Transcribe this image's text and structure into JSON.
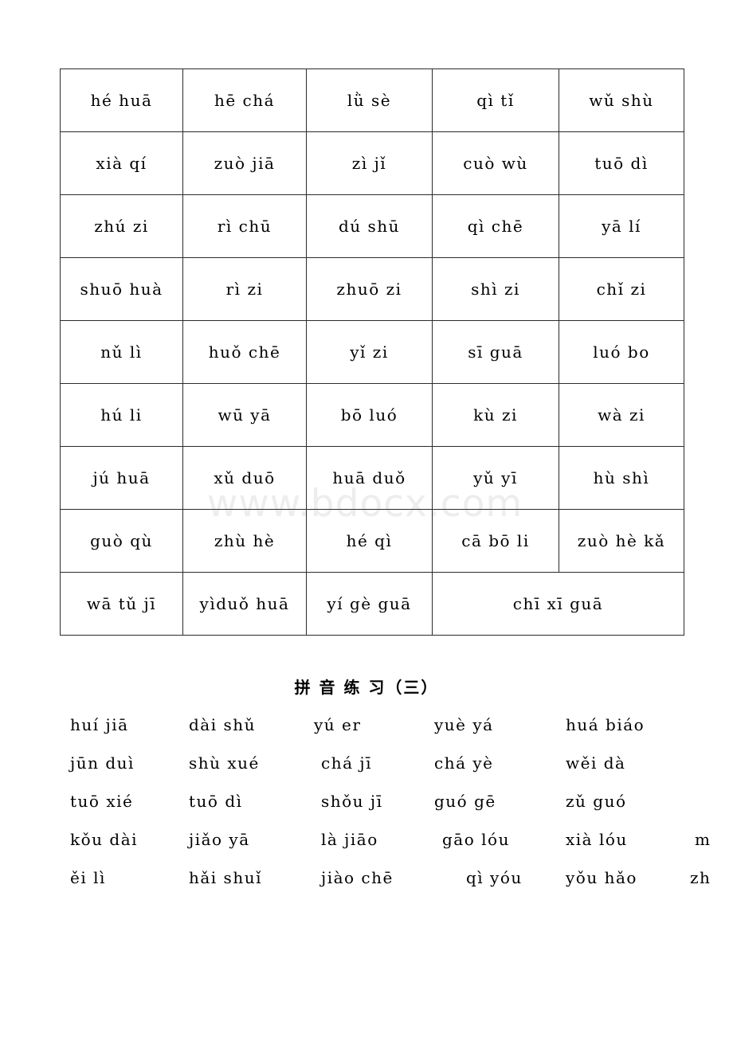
{
  "watermark": {
    "text": "www.bdocx.com",
    "color": "#ededed"
  },
  "pinyin_table": {
    "rows": [
      [
        "hé huā",
        "hē chá",
        "lǜ sè",
        "qì tǐ",
        "wǔ shù"
      ],
      [
        "xià qí",
        "zuò jiā",
        "zì jǐ",
        "cuò wù",
        "tuō dì"
      ],
      [
        "zhú zi",
        "rì chū",
        "dú shū",
        "qì chē",
        "yā lí"
      ],
      [
        "shuō huà",
        "rì zi",
        "zhuō zi",
        "shì zi",
        "chǐ zi"
      ],
      [
        "nǔ lì",
        "huǒ chē",
        "yǐ zi",
        "sī guā",
        "luó bo"
      ],
      [
        "hú li",
        "wū yā",
        "bō luó",
        "kù zi",
        "wà zi"
      ],
      [
        "jú huā",
        "xǔ duō",
        "huā duǒ",
        "yǔ yī",
        "hù shì"
      ],
      [
        "guò qù",
        "zhù hè",
        "hé qì",
        "cā bō li",
        "zuò hè kǎ"
      ]
    ],
    "last_row": {
      "cells": [
        "wā tǔ jī",
        "yìduǒ huā",
        "yí gè guā"
      ],
      "merged_cell": "chī xī guā"
    }
  },
  "section": {
    "heading": "拼 音 练 习（三）",
    "lines": [
      {
        "cells": [
          "huí jiā",
          "dài shǔ",
          "yú er",
          "yuè yá",
          "huá biáo"
        ],
        "stray": ""
      },
      {
        "cells": [
          "jūn duì",
          "shù xué",
          "chá jī",
          "chá yè",
          "wěi dà"
        ],
        "stray": ""
      },
      {
        "cells": [
          "tuō xié",
          "tuō dì",
          "shǒu jī",
          "guó gē",
          "zǔ guó"
        ],
        "stray": ""
      },
      {
        "cells": [
          "kǒu dài",
          "jiǎo yā",
          "là jiāo",
          "gāo lóu",
          "xià lóu"
        ],
        "stray": "m"
      },
      {
        "cells": [
          "ěi lì",
          "hǎi shuǐ",
          "jiào chē",
          "qì yóu",
          "yǒu hǎo"
        ],
        "stray": "zh"
      }
    ]
  }
}
